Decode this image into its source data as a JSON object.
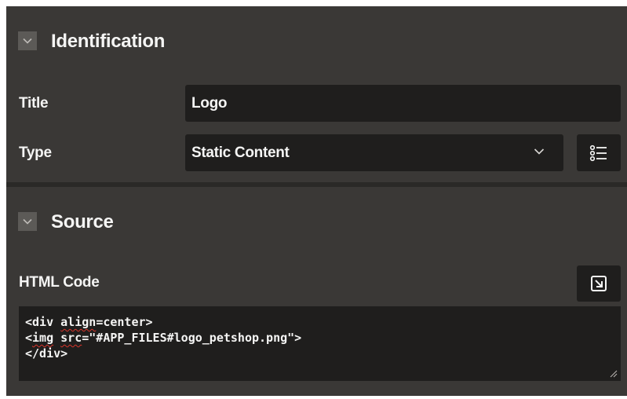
{
  "identification": {
    "title": "Identification",
    "collapse_icon": "chevron-down-icon",
    "title_field": {
      "label": "Title",
      "value": "Logo"
    },
    "type_field": {
      "label": "Type",
      "value": "Static Content",
      "dropdown_icon": "chevron-down-icon"
    },
    "list_button_icon": "list-icon"
  },
  "source": {
    "title": "Source",
    "collapse_icon": "chevron-down-icon",
    "html_code_label": "HTML Code",
    "expand_button_icon": "open-in-new-icon",
    "code": {
      "line1_pre": "<div ",
      "line1_word": "align",
      "line1_post": "=center>",
      "line2_pre": "<",
      "line2_word1": "img",
      "line2_mid": " ",
      "line2_word2": "src",
      "line2_post": "=\"#APP_FILES#logo_petshop.png\">",
      "line3": "</div>"
    }
  },
  "colors": {
    "panel_bg": "#3a3836",
    "field_bg": "#1f1e1d",
    "text": "#f5f5f4",
    "spellcheck": "#d9342b"
  }
}
